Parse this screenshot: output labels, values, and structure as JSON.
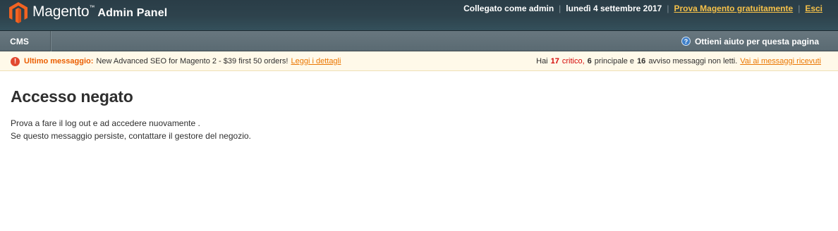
{
  "header": {
    "brand": "Magento",
    "trademark": "™",
    "subtitle": "Admin Panel",
    "logged_in": "Collegato come admin",
    "separator": "|",
    "date": "lunedì 4 settembre 2017",
    "try_link": "Prova Magento gratuitamente",
    "logout_link": "Esci"
  },
  "nav": {
    "items": [
      {
        "label": "CMS"
      }
    ],
    "help": {
      "icon": "question-icon",
      "glyph": "?",
      "label": "Ottieni aiuto per questa pagina"
    }
  },
  "notice": {
    "icon": "alert-icon",
    "icon_glyph": "!",
    "label": "Ultimo messaggio:",
    "message": "New Advanced SEO for Magento 2 - $39 first 50 orders!",
    "details_link": "Leggi i dettagli",
    "summary": {
      "prefix": "Hai",
      "critical_count": "17",
      "critical_word": "critico,",
      "major_count": "6",
      "major_word": "principale e",
      "minor_count": "16",
      "tail": "avviso messaggi non letti.",
      "link": "Vai ai messaggi ricevuti"
    }
  },
  "content": {
    "title": "Accesso negato",
    "line1": "Prova a fare il log out e ad accedere nuovamente .",
    "line2": "Se questo messaggio persiste, contattare il gestore del negozio."
  },
  "colors": {
    "header_bg": "#2e434d",
    "nav_bg": "#5f6f77",
    "link_orange": "#f5c049",
    "notice_bg": "#fff9e9",
    "critical_red": "#d40707",
    "logo_orange": "#f26322"
  }
}
